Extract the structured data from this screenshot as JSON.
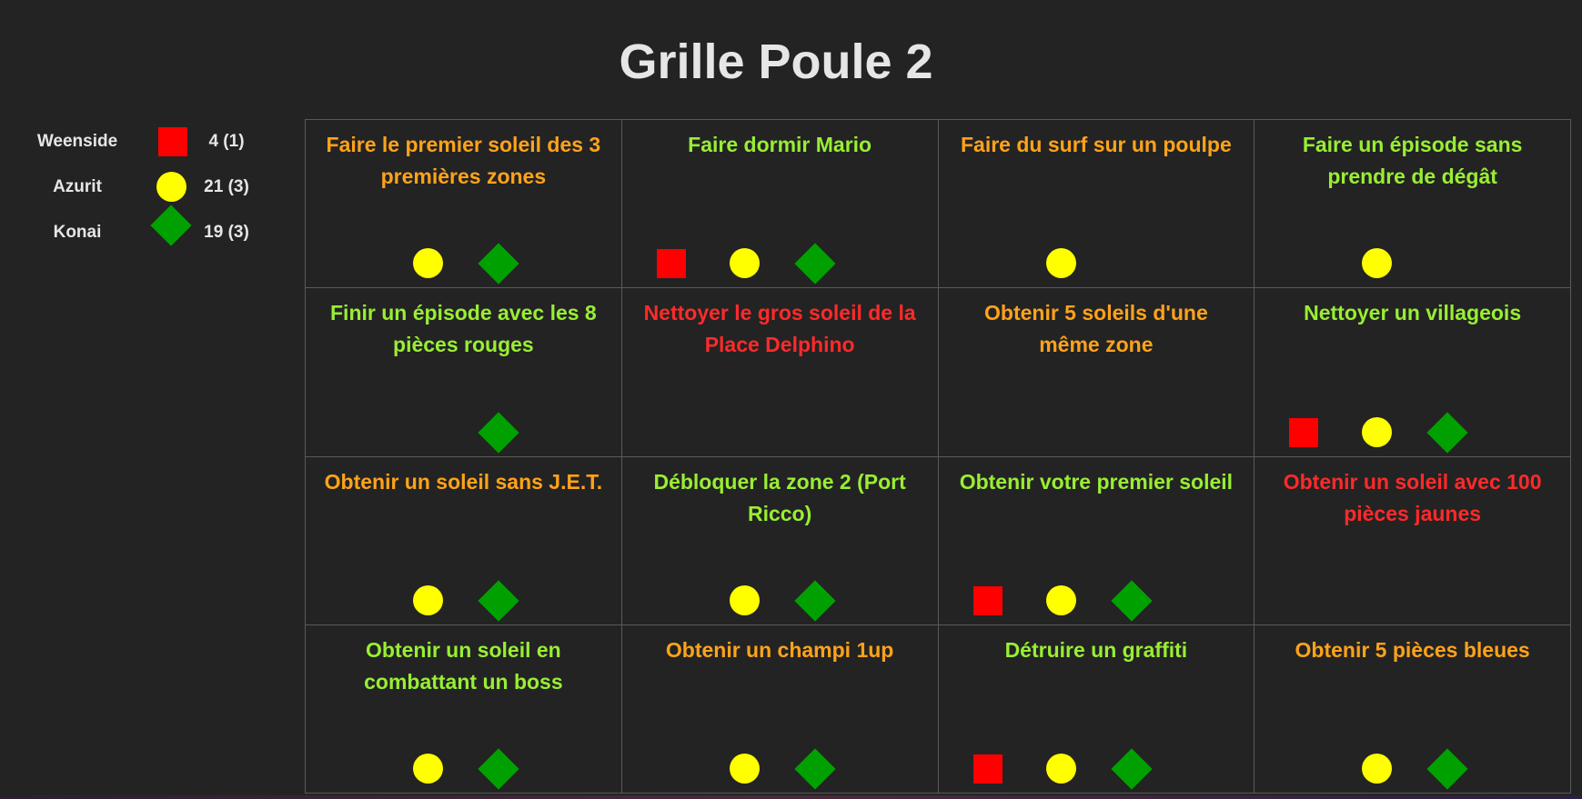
{
  "title": "Grille Poule 2",
  "colors": {
    "background": "#232323",
    "grid_line": "#5a5a5a",
    "easy": "#99ee33",
    "medium": "#ffa31a",
    "hard": "#ff2a2a",
    "weenside": "#ff0000",
    "azurit": "#ffff00",
    "konai": "#00a000"
  },
  "legend": [
    {
      "name": "Weenside",
      "score": "4 (1)",
      "shape": "square",
      "color": "#ff0000"
    },
    {
      "name": "Azurit",
      "score": "21 (3)",
      "shape": "circle",
      "color": "#ffff00"
    },
    {
      "name": "Konai",
      "score": "19 (3)",
      "shape": "diamond",
      "color": "#00a000"
    }
  ],
  "cells": [
    {
      "text": "Faire le premier soleil des 3 premières zones",
      "difficulty": "medium",
      "marks": [
        "azurit",
        "konai"
      ]
    },
    {
      "text": "Faire dormir Mario",
      "difficulty": "easy",
      "marks": [
        "weenside",
        "azurit",
        "konai"
      ]
    },
    {
      "text": "Faire du surf sur un poulpe",
      "difficulty": "medium",
      "marks": [
        "azurit"
      ]
    },
    {
      "text": "Faire un épisode sans prendre de dégât",
      "difficulty": "easy",
      "marks": [
        "azurit"
      ]
    },
    {
      "text": "Finir un épisode avec les 8 pièces rouges",
      "difficulty": "easy",
      "marks": [
        "konai"
      ]
    },
    {
      "text": "Nettoyer le gros soleil de la Place Delphino",
      "difficulty": "hard",
      "marks": []
    },
    {
      "text": "Obtenir 5 soleils d'une même zone",
      "difficulty": "medium",
      "marks": []
    },
    {
      "text": "Nettoyer un villageois",
      "difficulty": "easy",
      "marks": [
        "weenside",
        "azurit",
        "konai"
      ]
    },
    {
      "text": "Obtenir un soleil sans J.E.T.",
      "difficulty": "medium",
      "marks": [
        "azurit",
        "konai"
      ]
    },
    {
      "text": "Débloquer la zone 2 (Port Ricco)",
      "difficulty": "easy",
      "marks": [
        "azurit",
        "konai"
      ]
    },
    {
      "text": "Obtenir votre premier soleil",
      "difficulty": "easy",
      "marks": [
        "weenside",
        "azurit",
        "konai"
      ]
    },
    {
      "text": "Obtenir un soleil avec 100 pièces jaunes",
      "difficulty": "hard",
      "marks": []
    },
    {
      "text": "Obtenir un soleil en combattant un boss",
      "difficulty": "easy",
      "marks": [
        "azurit",
        "konai"
      ]
    },
    {
      "text": "Obtenir un champi 1up",
      "difficulty": "medium",
      "marks": [
        "azurit",
        "konai"
      ]
    },
    {
      "text": "Détruire un graffiti",
      "difficulty": "easy",
      "marks": [
        "weenside",
        "azurit",
        "konai"
      ]
    },
    {
      "text": "Obtenir 5 pièces bleues",
      "difficulty": "medium",
      "marks": [
        "azurit",
        "konai"
      ]
    }
  ]
}
